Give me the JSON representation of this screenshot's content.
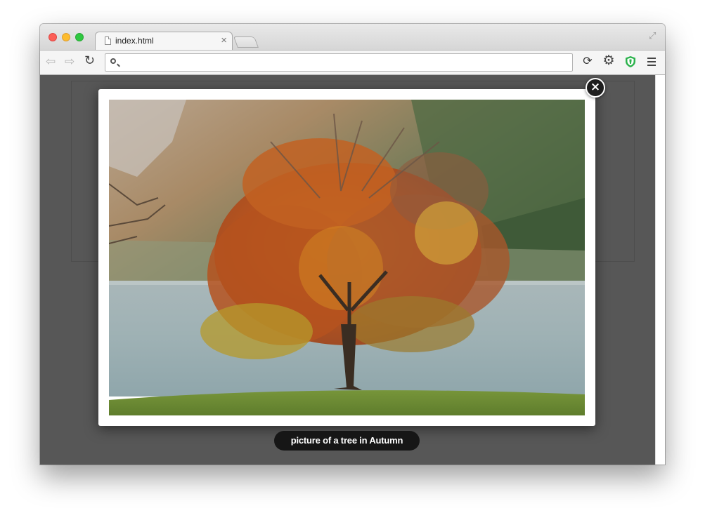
{
  "browser": {
    "tab_title": "index.html",
    "tab_close": "×",
    "address_value": "",
    "address_placeholder": ""
  },
  "toolbar": {
    "back_icon": "arrow-left-icon",
    "forward_icon": "arrow-right-icon",
    "reload_icon": "reload-icon",
    "extensions": [
      "sync-icon",
      "gear-icon",
      "shield-icon",
      "menu-icon"
    ],
    "shield_color": "#2bb24c"
  },
  "lightbox": {
    "image_subject": "tree in autumn",
    "close_label": "×",
    "caption": "picture of a tree in Autumn"
  },
  "colors": {
    "overlay": "#575757",
    "caption_bg": "#161616"
  }
}
